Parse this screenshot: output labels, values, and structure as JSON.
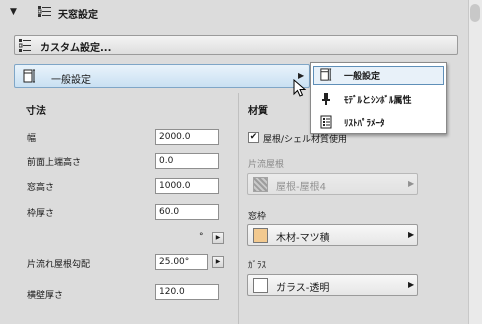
{
  "header": {
    "title": "天窓設定"
  },
  "custom_button": {
    "label": "カスタム設定..."
  },
  "general_button": {
    "label": "一般設定"
  },
  "dimensions": {
    "section_title": "寸法",
    "rows": [
      {
        "label": "幅",
        "value": "2000.0"
      },
      {
        "label": "前面上端高さ",
        "value": "0.0"
      },
      {
        "label": "窓高さ",
        "value": "1000.0"
      },
      {
        "label": "枠厚さ",
        "value": "60.0"
      }
    ],
    "angle_unit": "°",
    "slope": {
      "label": "片流れ屋根勾配",
      "value": "25.00°"
    },
    "wall": {
      "label": "横壁厚さ",
      "value": "120.0"
    }
  },
  "materials": {
    "section_title": "材質",
    "checkbox": {
      "label": "屋根/シェル材質使用",
      "checked": true
    },
    "roof": {
      "label": "片流屋根",
      "value": "屋根-屋根4"
    },
    "frame": {
      "label": "窓枠",
      "value": "木材-マツ積",
      "swatch": "#f2c98f"
    },
    "glass": {
      "label": "ｶﾞﾗｽ",
      "value": "ガラス-透明",
      "swatch": "#ffffff"
    }
  },
  "menu": {
    "items": [
      {
        "label": "一般設定",
        "icon": "window-frame-icon",
        "selected": true
      },
      {
        "label": "ﾓﾃﾞﾙとｼﾝﾎﾞﾙ属性",
        "icon": "model-symbol-icon",
        "selected": false
      },
      {
        "label": "ﾘｽﾄﾊﾟﾗﾒｰﾀ",
        "icon": "list-icon",
        "selected": false
      }
    ]
  }
}
